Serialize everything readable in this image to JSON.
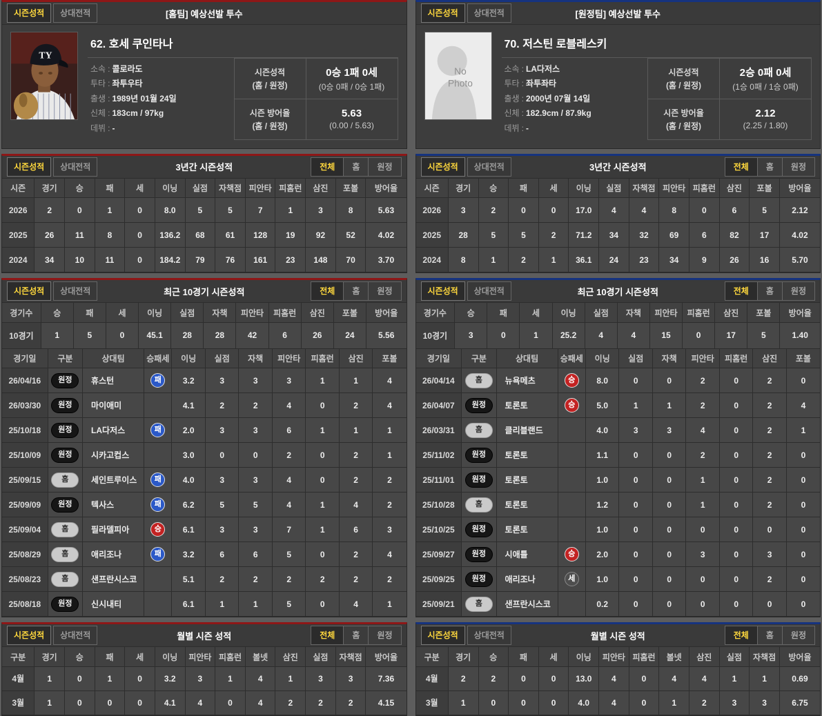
{
  "shared": {
    "tabs": [
      {
        "id": "season-stats",
        "label": "시즌성적",
        "active": true
      },
      {
        "id": "head-to-head",
        "label": "상대전적",
        "active": false
      }
    ],
    "filters": [
      {
        "id": "all",
        "label": "전체",
        "active": true
      },
      {
        "id": "home",
        "label": "홈",
        "active": false
      },
      {
        "id": "away",
        "label": "원정",
        "active": false
      }
    ],
    "badge_styles": {
      "원정": "venue-dark",
      "홈": "venue-light",
      "승": "result-win",
      "패": "result-loss",
      "세": "result-save"
    },
    "colors": {
      "home_accent": "#8e1717",
      "away_accent": "#16337f",
      "active_tab_text": "#ffd83d",
      "win_badge": "#c32222",
      "loss_badge": "#2b59c8",
      "save_badge": "#4e4e4e"
    }
  },
  "panels": [
    {
      "id": "home",
      "accent": "#8e1717",
      "header_title": "[홈팀] 예상선발 투수",
      "player": {
        "name": "62. 호세 쿠인타나",
        "photo": {
          "type": "photo",
          "cap_logo": "TY"
        },
        "info": [
          {
            "label": "소속",
            "value": "콜로라도"
          },
          {
            "label": "투타",
            "value": "좌투우타"
          },
          {
            "label": "출생",
            "value": "1989년 01월 24일"
          },
          {
            "label": "신체",
            "value": "183cm / 97kg"
          },
          {
            "label": "데뷔",
            "value": "-"
          }
        ],
        "stat_boxes": [
          {
            "label": "시즌성적",
            "sublabel": "(홈 / 원정)",
            "value": "0승 1패 0세",
            "subvalue": "(0승 0패 / 0승 1패)"
          },
          {
            "label": "시즌 방어율",
            "sublabel": "(홈 / 원정)",
            "value": "5.63",
            "subvalue": "(0.00 / 5.63)"
          }
        ]
      },
      "three_year": {
        "title": "3년간 시즌성적",
        "columns": [
          "시즌",
          "경기",
          "승",
          "패",
          "세",
          "이닝",
          "실점",
          "자책점",
          "피안타",
          "피홈런",
          "삼진",
          "포볼",
          "방어율"
        ],
        "rows": [
          [
            "2026",
            "2",
            "0",
            "1",
            "0",
            "8.0",
            "5",
            "5",
            "7",
            "1",
            "3",
            "8",
            "5.63"
          ],
          [
            "2025",
            "26",
            "11",
            "8",
            "0",
            "136.2",
            "68",
            "61",
            "128",
            "19",
            "92",
            "52",
            "4.02"
          ],
          [
            "2024",
            "34",
            "10",
            "11",
            "0",
            "184.2",
            "79",
            "76",
            "161",
            "23",
            "148",
            "70",
            "3.70"
          ]
        ]
      },
      "recent": {
        "title": "최근 10경기 시즌성적",
        "summary_columns": [
          "경기수",
          "승",
          "패",
          "세",
          "이닝",
          "실점",
          "자책",
          "피안타",
          "피홈런",
          "삼진",
          "포볼",
          "방어율"
        ],
        "summary_rows": [
          [
            "10경기",
            "1",
            "5",
            "0",
            "45.1",
            "28",
            "28",
            "42",
            "6",
            "26",
            "24",
            "5.56"
          ]
        ],
        "log_columns": [
          "경기일",
          "구분",
          "상대팀",
          "승패세",
          "이닝",
          "실점",
          "자책",
          "피안타",
          "피홈런",
          "삼진",
          "포볼"
        ],
        "log_rows": [
          {
            "date": "26/04/16",
            "venue": "원정",
            "opponent": "휴스턴",
            "result": "패",
            "stats": [
              "3.2",
              "3",
              "3",
              "3",
              "1",
              "1",
              "4"
            ]
          },
          {
            "date": "26/03/30",
            "venue": "원정",
            "opponent": "마이애미",
            "result": "",
            "stats": [
              "4.1",
              "2",
              "2",
              "4",
              "0",
              "2",
              "4"
            ]
          },
          {
            "date": "25/10/18",
            "venue": "원정",
            "opponent": "LA다저스",
            "result": "패",
            "stats": [
              "2.0",
              "3",
              "3",
              "6",
              "1",
              "1",
              "1"
            ]
          },
          {
            "date": "25/10/09",
            "venue": "원정",
            "opponent": "시카고컵스",
            "result": "",
            "stats": [
              "3.0",
              "0",
              "0",
              "2",
              "0",
              "2",
              "1"
            ]
          },
          {
            "date": "25/09/15",
            "venue": "홈",
            "opponent": "세인트루이스",
            "result": "패",
            "stats": [
              "4.0",
              "3",
              "3",
              "4",
              "0",
              "2",
              "2"
            ]
          },
          {
            "date": "25/09/09",
            "venue": "원정",
            "opponent": "텍사스",
            "result": "패",
            "stats": [
              "6.2",
              "5",
              "5",
              "4",
              "1",
              "4",
              "2"
            ]
          },
          {
            "date": "25/09/04",
            "venue": "홈",
            "opponent": "필라델피아",
            "result": "승",
            "stats": [
              "6.1",
              "3",
              "3",
              "7",
              "1",
              "6",
              "3"
            ]
          },
          {
            "date": "25/08/29",
            "venue": "홈",
            "opponent": "애리조나",
            "result": "패",
            "stats": [
              "3.2",
              "6",
              "6",
              "5",
              "0",
              "2",
              "4"
            ]
          },
          {
            "date": "25/08/23",
            "venue": "홈",
            "opponent": "샌프란시스코",
            "result": "",
            "stats": [
              "5.1",
              "2",
              "2",
              "2",
              "2",
              "2",
              "2"
            ]
          },
          {
            "date": "25/08/18",
            "venue": "원정",
            "opponent": "신시내티",
            "result": "",
            "stats": [
              "6.1",
              "1",
              "1",
              "5",
              "0",
              "4",
              "1"
            ]
          }
        ]
      },
      "monthly": {
        "title": "월별 시즌 성적",
        "columns": [
          "구분",
          "경기",
          "승",
          "패",
          "세",
          "이닝",
          "피안타",
          "피홈런",
          "볼넷",
          "삼진",
          "실점",
          "자책점",
          "방어율"
        ],
        "rows": [
          [
            "4월",
            "1",
            "0",
            "1",
            "0",
            "3.2",
            "3",
            "1",
            "4",
            "1",
            "3",
            "3",
            "7.36"
          ],
          [
            "3월",
            "1",
            "0",
            "0",
            "0",
            "4.1",
            "4",
            "0",
            "4",
            "2",
            "2",
            "2",
            "4.15"
          ]
        ]
      }
    },
    {
      "id": "away",
      "accent": "#16337f",
      "header_title": "[원정팀] 예상선발 투수",
      "player": {
        "name": "70. 저스틴 로블레스키",
        "photo": {
          "type": "no_photo",
          "text_lines": [
            "No",
            "Photo"
          ]
        },
        "info": [
          {
            "label": "소속",
            "value": "LA다저스"
          },
          {
            "label": "투타",
            "value": "좌투좌타"
          },
          {
            "label": "출생",
            "value": "2000년 07월 14일"
          },
          {
            "label": "신체",
            "value": "182.9cm / 87.9kg"
          },
          {
            "label": "데뷔",
            "value": "-"
          }
        ],
        "stat_boxes": [
          {
            "label": "시즌성적",
            "sublabel": "(홈 / 원정)",
            "value": "2승 0패 0세",
            "subvalue": "(1승 0패 / 1승 0패)"
          },
          {
            "label": "시즌 방어율",
            "sublabel": "(홈 / 원정)",
            "value": "2.12",
            "subvalue": "(2.25 / 1.80)"
          }
        ]
      },
      "three_year": {
        "title": "3년간 시즌성적",
        "columns": [
          "시즌",
          "경기",
          "승",
          "패",
          "세",
          "이닝",
          "실점",
          "자책점",
          "피안타",
          "피홈런",
          "삼진",
          "포볼",
          "방어율"
        ],
        "rows": [
          [
            "2026",
            "3",
            "2",
            "0",
            "0",
            "17.0",
            "4",
            "4",
            "8",
            "0",
            "6",
            "5",
            "2.12"
          ],
          [
            "2025",
            "28",
            "5",
            "5",
            "2",
            "71.2",
            "34",
            "32",
            "69",
            "6",
            "82",
            "17",
            "4.02"
          ],
          [
            "2024",
            "8",
            "1",
            "2",
            "1",
            "36.1",
            "24",
            "23",
            "34",
            "9",
            "26",
            "16",
            "5.70"
          ]
        ]
      },
      "recent": {
        "title": "최근 10경기 시즌성적",
        "summary_columns": [
          "경기수",
          "승",
          "패",
          "세",
          "이닝",
          "실점",
          "자책",
          "피안타",
          "피홈런",
          "삼진",
          "포볼",
          "방어율"
        ],
        "summary_rows": [
          [
            "10경기",
            "3",
            "0",
            "1",
            "25.2",
            "4",
            "4",
            "15",
            "0",
            "17",
            "5",
            "1.40"
          ]
        ],
        "log_columns": [
          "경기일",
          "구분",
          "상대팀",
          "승패세",
          "이닝",
          "실점",
          "자책",
          "피안타",
          "피홈런",
          "삼진",
          "포볼"
        ],
        "log_rows": [
          {
            "date": "26/04/14",
            "venue": "홈",
            "opponent": "뉴욕메츠",
            "result": "승",
            "stats": [
              "8.0",
              "0",
              "0",
              "2",
              "0",
              "2",
              "0"
            ]
          },
          {
            "date": "26/04/07",
            "venue": "원정",
            "opponent": "토론토",
            "result": "승",
            "stats": [
              "5.0",
              "1",
              "1",
              "2",
              "0",
              "2",
              "4"
            ]
          },
          {
            "date": "26/03/31",
            "venue": "홈",
            "opponent": "클리블랜드",
            "result": "",
            "stats": [
              "4.0",
              "3",
              "3",
              "4",
              "0",
              "2",
              "1"
            ]
          },
          {
            "date": "25/11/02",
            "venue": "원정",
            "opponent": "토론토",
            "result": "",
            "stats": [
              "1.1",
              "0",
              "0",
              "2",
              "0",
              "2",
              "0"
            ]
          },
          {
            "date": "25/11/01",
            "venue": "원정",
            "opponent": "토론토",
            "result": "",
            "stats": [
              "1.0",
              "0",
              "0",
              "1",
              "0",
              "2",
              "0"
            ]
          },
          {
            "date": "25/10/28",
            "venue": "홈",
            "opponent": "토론토",
            "result": "",
            "stats": [
              "1.2",
              "0",
              "0",
              "1",
              "0",
              "2",
              "0"
            ]
          },
          {
            "date": "25/10/25",
            "venue": "원정",
            "opponent": "토론토",
            "result": "",
            "stats": [
              "1.0",
              "0",
              "0",
              "0",
              "0",
              "0",
              "0"
            ]
          },
          {
            "date": "25/09/27",
            "venue": "원정",
            "opponent": "시애틀",
            "result": "승",
            "stats": [
              "2.0",
              "0",
              "0",
              "3",
              "0",
              "3",
              "0"
            ]
          },
          {
            "date": "25/09/25",
            "venue": "원정",
            "opponent": "애리조나",
            "result": "세",
            "stats": [
              "1.0",
              "0",
              "0",
              "0",
              "0",
              "2",
              "0"
            ]
          },
          {
            "date": "25/09/21",
            "venue": "홈",
            "opponent": "샌프란시스코",
            "result": "",
            "stats": [
              "0.2",
              "0",
              "0",
              "0",
              "0",
              "0",
              "0"
            ]
          }
        ]
      },
      "monthly": {
        "title": "월별 시즌 성적",
        "columns": [
          "구분",
          "경기",
          "승",
          "패",
          "세",
          "이닝",
          "피안타",
          "피홈런",
          "볼넷",
          "삼진",
          "실점",
          "자책점",
          "방어율"
        ],
        "rows": [
          [
            "4월",
            "2",
            "2",
            "0",
            "0",
            "13.0",
            "4",
            "0",
            "4",
            "4",
            "1",
            "1",
            "0.69"
          ],
          [
            "3월",
            "1",
            "0",
            "0",
            "0",
            "4.0",
            "4",
            "0",
            "1",
            "2",
            "3",
            "3",
            "6.75"
          ]
        ]
      }
    }
  ]
}
